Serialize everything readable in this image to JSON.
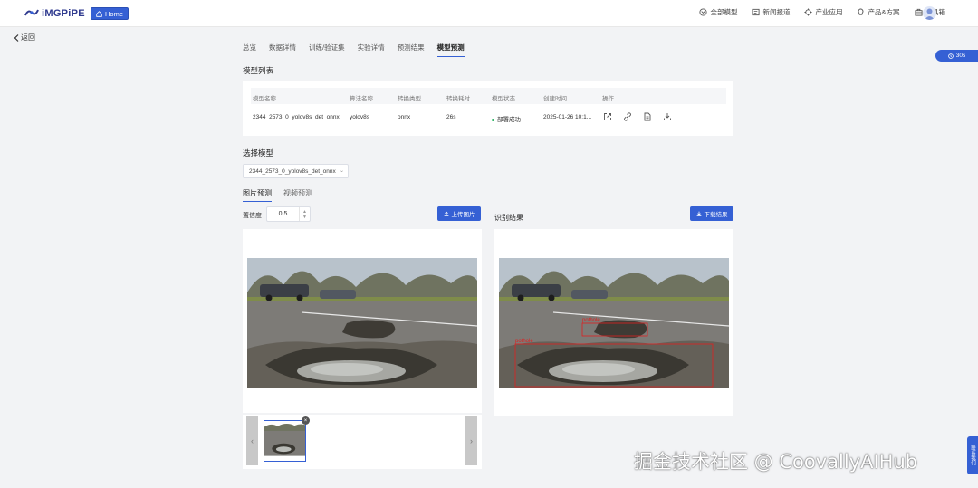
{
  "header": {
    "logo_text": "iMGPiPE",
    "home_label": "Home",
    "nav": [
      {
        "label": "全部模型",
        "icon": "model-icon"
      },
      {
        "label": "新闻报道",
        "icon": "news-icon"
      },
      {
        "label": "产业应用",
        "icon": "industry-icon"
      },
      {
        "label": "产品&方案",
        "icon": "product-icon"
      },
      {
        "label": "工具箱",
        "icon": "toolbox-icon"
      }
    ]
  },
  "back_label": "返回",
  "timer_label": "30s",
  "side_tab_label": "联系我们",
  "tabs": [
    {
      "label": "总览",
      "active": false
    },
    {
      "label": "数据详情",
      "active": false
    },
    {
      "label": "训练/验证集",
      "active": false
    },
    {
      "label": "实验详情",
      "active": false
    },
    {
      "label": "预测结果",
      "active": false
    },
    {
      "label": "模型预测",
      "active": true
    }
  ],
  "model_list": {
    "title": "模型列表",
    "columns": [
      "模型名称",
      "算法名称",
      "转换类型",
      "转换耗时",
      "模型状态",
      "创建时间",
      "操作"
    ],
    "rows": [
      {
        "name": "2344_2573_0_yolov8s_det_onnx",
        "algorithm": "yolov8s",
        "convert_type": "onnx",
        "convert_time": "26s",
        "status": "部署成功",
        "created": "2025-01-26 10:1..."
      }
    ]
  },
  "select_model": {
    "title": "选择模型",
    "value": "2344_2573_0_yolov8s_det_onnx"
  },
  "subtabs": [
    {
      "label": "图片预测",
      "active": true
    },
    {
      "label": "视频预测",
      "active": false
    }
  ],
  "confidence": {
    "label": "置信度",
    "value": "0.5"
  },
  "upload_label": "上传图片",
  "result_title": "识别结果",
  "download_label": "下载结果",
  "detections": [
    {
      "label": "pothole"
    },
    {
      "label": "pothole"
    }
  ],
  "watermark": "掘金技术社区 @ CoovallyAIHub",
  "colors": {
    "accent": "#3560d4",
    "detection": "#e02020",
    "status_ok": "#2fb566"
  }
}
